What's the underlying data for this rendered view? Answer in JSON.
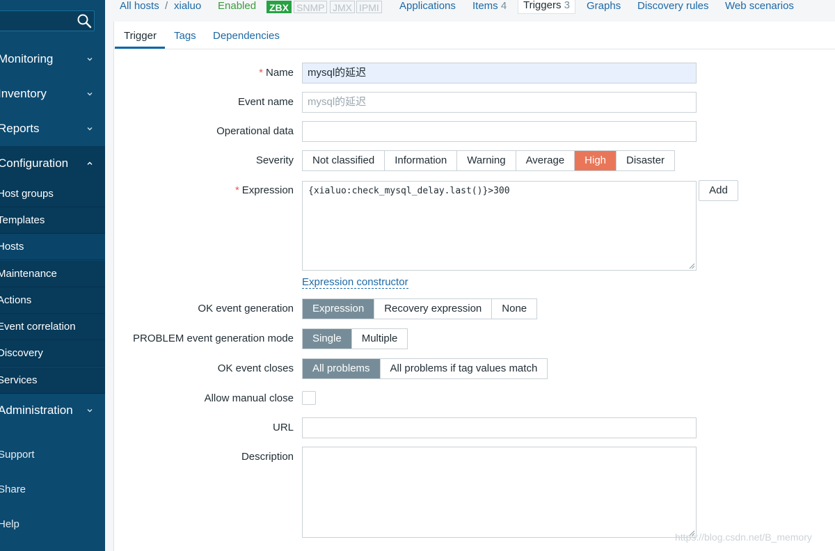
{
  "sidebar": {
    "search": {
      "value": ""
    },
    "menu": [
      {
        "label": "Monitoring"
      },
      {
        "label": "Inventory"
      },
      {
        "label": "Reports"
      },
      {
        "label": "Configuration"
      },
      {
        "label": "Administration"
      }
    ],
    "config_submenu": [
      {
        "label": "Host groups"
      },
      {
        "label": "Templates"
      },
      {
        "label": "Hosts"
      },
      {
        "label": "Maintenance"
      },
      {
        "label": "Actions"
      },
      {
        "label": "Event correlation"
      },
      {
        "label": "Discovery"
      },
      {
        "label": "Services"
      }
    ],
    "bottom": [
      {
        "label": "Support"
      },
      {
        "label": "Share"
      },
      {
        "label": "Help"
      }
    ]
  },
  "header": {
    "all_hosts": "All hosts",
    "separator": "/",
    "host": "xialuo",
    "status": "Enabled",
    "tags": [
      "ZBX",
      "SNMP",
      "JMX",
      "IPMI"
    ],
    "nav": {
      "applications": "Applications",
      "items": "Items",
      "items_count": "4",
      "triggers": "Triggers",
      "triggers_count": "3",
      "graphs": "Graphs",
      "discovery_rules": "Discovery rules",
      "web_scenarios": "Web scenarios"
    }
  },
  "tabs": [
    "Trigger",
    "Tags",
    "Dependencies"
  ],
  "form": {
    "required_mark": "*",
    "name": {
      "label": "Name",
      "value": "mysql的延迟"
    },
    "event_name": {
      "label": "Event name",
      "placeholder": "mysql的延迟"
    },
    "operational_data": {
      "label": "Operational data",
      "value": ""
    },
    "severity": {
      "label": "Severity",
      "options": [
        "Not classified",
        "Information",
        "Warning",
        "Average",
        "High",
        "Disaster"
      ],
      "selected": "High"
    },
    "expression": {
      "label": "Expression",
      "value": "{xialuo:check_mysql_delay.last()}>300",
      "add_label": "Add",
      "constructor_link": "Expression constructor"
    },
    "ok_event_generation": {
      "label": "OK event generation",
      "options": [
        "Expression",
        "Recovery expression",
        "None"
      ],
      "selected": "Expression"
    },
    "problem_mode": {
      "label": "PROBLEM event generation mode",
      "options": [
        "Single",
        "Multiple"
      ],
      "selected": "Single"
    },
    "ok_event_closes": {
      "label": "OK event closes",
      "options": [
        "All problems",
        "All problems if tag values match"
      ],
      "selected": "All problems"
    },
    "allow_manual_close": {
      "label": "Allow manual close",
      "checked": false
    },
    "url": {
      "label": "URL",
      "value": ""
    },
    "description": {
      "label": "Description",
      "value": ""
    }
  },
  "watermark": "https://blog.csdn.net/B_memory",
  "colors": {
    "sidebar": "#0c4a70",
    "accent": "#1d69a5",
    "high": "#e97659",
    "selected": "#768d99",
    "enabled": "#27a243"
  }
}
